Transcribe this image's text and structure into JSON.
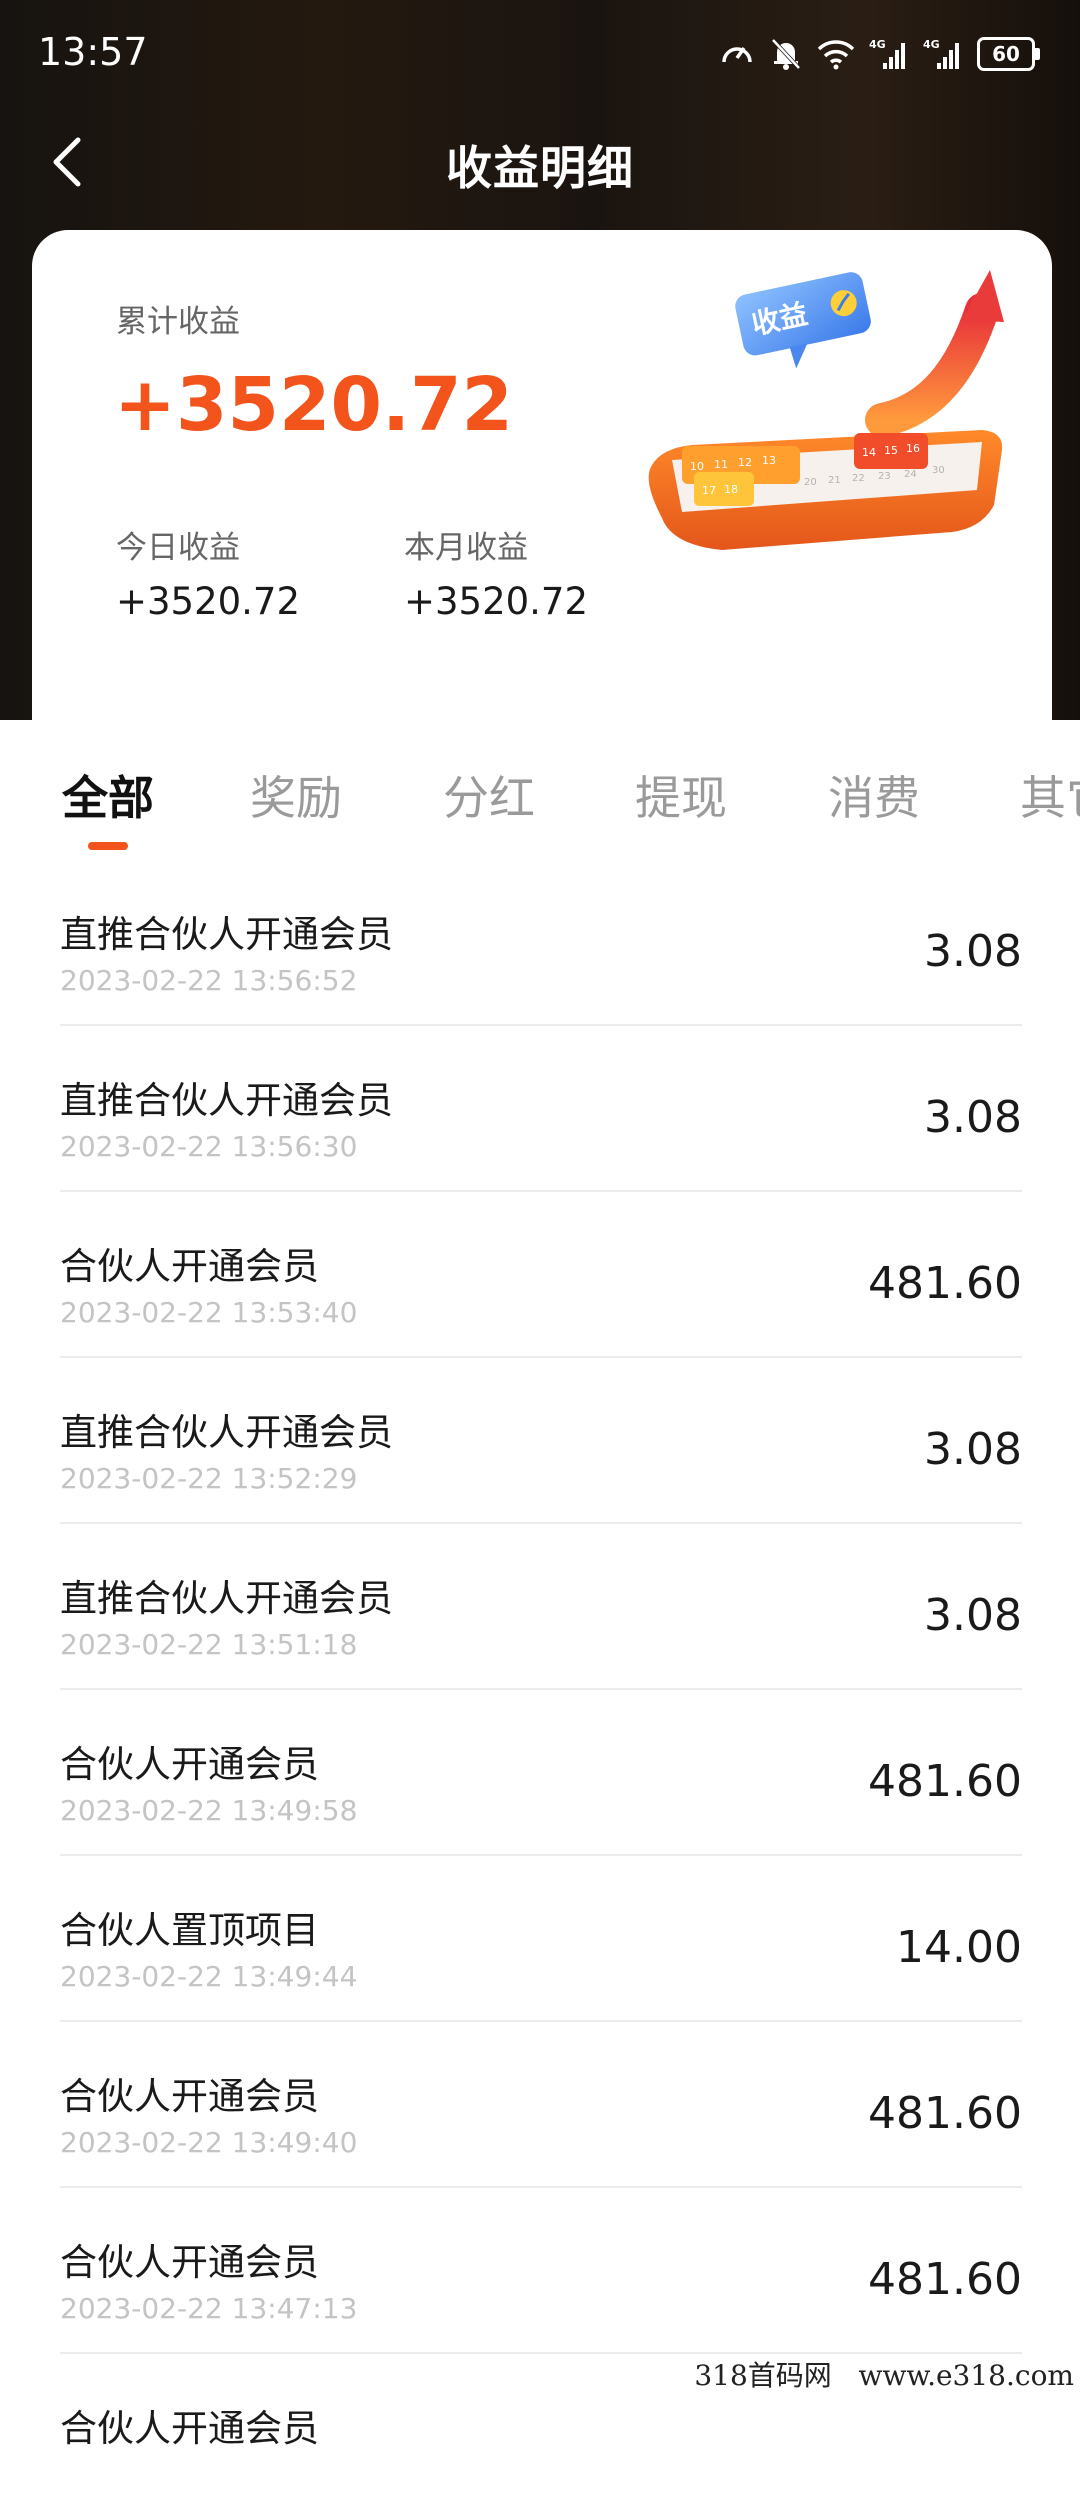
{
  "status_bar": {
    "time": "13:57",
    "battery": "60"
  },
  "nav": {
    "title": "收益明细"
  },
  "summary": {
    "total_label": "累计收益",
    "total_value": "+3520.72",
    "today_label": "今日收益",
    "today_value": "+3520.72",
    "month_label": "本月收益",
    "month_value": "+3520.72",
    "badge_text": "收益"
  },
  "colors": {
    "accent": "#f2541b",
    "header_bg": "#1e1712"
  },
  "tabs": [
    {
      "label": "全部",
      "active": true
    },
    {
      "label": "奖励",
      "active": false
    },
    {
      "label": "分红",
      "active": false
    },
    {
      "label": "提现",
      "active": false
    },
    {
      "label": "消费",
      "active": false
    },
    {
      "label": "其它",
      "active": false
    }
  ],
  "records": [
    {
      "title": "直推合伙人开通会员",
      "time": "2023-02-22 13:56:52",
      "amount": "3.08"
    },
    {
      "title": "直推合伙人开通会员",
      "time": "2023-02-22 13:56:30",
      "amount": "3.08"
    },
    {
      "title": "合伙人开通会员",
      "time": "2023-02-22 13:53:40",
      "amount": "481.60"
    },
    {
      "title": "直推合伙人开通会员",
      "time": "2023-02-22 13:52:29",
      "amount": "3.08"
    },
    {
      "title": "直推合伙人开通会员",
      "time": "2023-02-22 13:51:18",
      "amount": "3.08"
    },
    {
      "title": "合伙人开通会员",
      "time": "2023-02-22 13:49:58",
      "amount": "481.60"
    },
    {
      "title": "合伙人置顶项目",
      "time": "2023-02-22 13:49:44",
      "amount": "14.00"
    },
    {
      "title": "合伙人开通会员",
      "time": "2023-02-22 13:49:40",
      "amount": "481.60"
    },
    {
      "title": "合伙人开通会员",
      "time": "2023-02-22 13:47:13",
      "amount": "481.60"
    },
    {
      "title": "合伙人开通会员",
      "time": "",
      "amount": ""
    }
  ],
  "watermark": "318首码网   www.e318.com"
}
